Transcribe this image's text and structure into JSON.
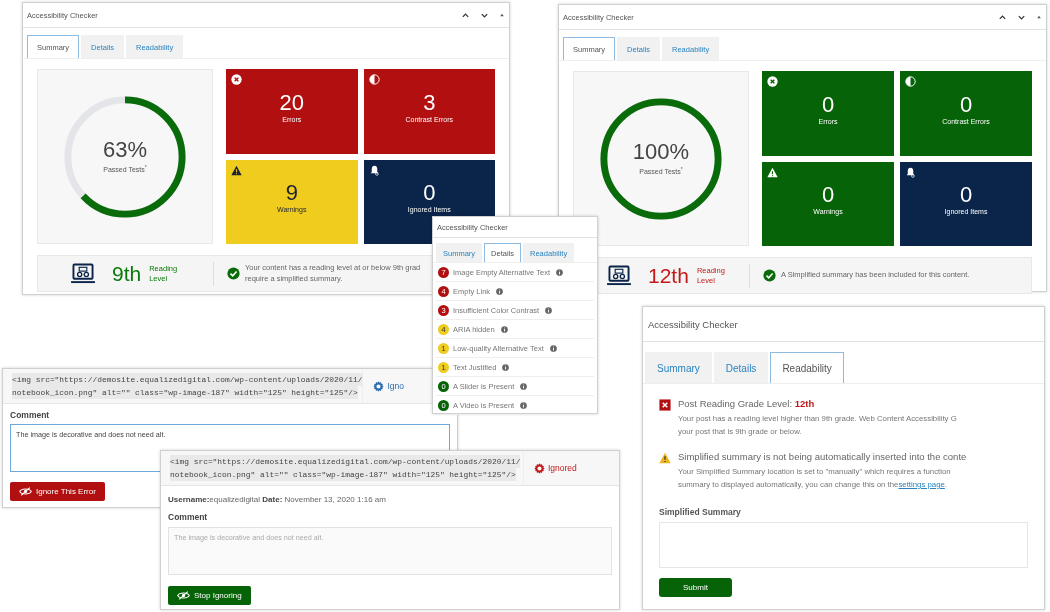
{
  "summary_panels": [
    {
      "title": "Accessibility Checker",
      "tabs": [
        {
          "label": "Summary",
          "selected": true
        },
        {
          "label": "Details",
          "selected": false
        },
        {
          "label": "Readability",
          "selected": false
        }
      ],
      "score": "63%",
      "score_label": "Passed Tests",
      "score_mark": "*",
      "level": 0.63,
      "tiles": [
        {
          "kind": "error",
          "count": "20",
          "label": "Errors",
          "color": "#b20f10"
        },
        {
          "kind": "contrast",
          "count": "3",
          "label": "Contrast Errors",
          "color": "#b20f10"
        },
        {
          "kind": "warning",
          "count": "9",
          "label": "Warnings",
          "color": "#f0cc1e"
        },
        {
          "kind": "ignored",
          "count": "0",
          "label": "Ignored Items",
          "color": "#0b254a"
        }
      ],
      "reading": {
        "grade": "9th",
        "label": [
          "Reading",
          "Level"
        ],
        "passed": true,
        "message_lines": [
          "Your content has a reading level at or below 9th grad",
          "require a simplified summary."
        ]
      }
    },
    {
      "title": "Accessibility Checker",
      "tabs": [
        {
          "label": "Summary",
          "selected": true
        },
        {
          "label": "Details",
          "selected": false
        },
        {
          "label": "Readability",
          "selected": false
        }
      ],
      "score": "100%",
      "score_label": "Passed Tests",
      "score_mark": "*",
      "level": 1,
      "tiles": [
        {
          "kind": "error",
          "count": "0",
          "label": "Errors",
          "color": "#076307"
        },
        {
          "kind": "contrast",
          "count": "0",
          "label": "Contrast Errors",
          "color": "#076307"
        },
        {
          "kind": "warning",
          "count": "0",
          "label": "Warnings",
          "color": "#076307"
        },
        {
          "kind": "ignored",
          "count": "0",
          "label": "Ignored Items",
          "color": "#0b254a"
        }
      ],
      "reading": {
        "grade": "12th",
        "label": [
          "Reading",
          "Level"
        ],
        "passed": false,
        "message_lines": [
          "A Simplified summary has been included for this content."
        ]
      }
    }
  ],
  "details_panel": {
    "title": "Accessibility Checker",
    "tabs": [
      {
        "label": "Summary",
        "selected": false
      },
      {
        "label": "Details",
        "selected": true
      },
      {
        "label": "Readability",
        "selected": false
      }
    ],
    "items": [
      {
        "count": "7",
        "label": "Image Empty Alternative Text",
        "color": "#b20f10"
      },
      {
        "count": "4",
        "label": "Empty Link",
        "color": "#b20f10"
      },
      {
        "count": "3",
        "label": "Insufficient Color Contrast",
        "color": "#b20f10"
      },
      {
        "count": "4",
        "label": "ARIA hidden",
        "color": "#f0cc1e"
      },
      {
        "count": "1",
        "label": "Low-quality Alternative Text",
        "color": "#f0cc1e"
      },
      {
        "count": "1",
        "label": "Text Justified",
        "color": "#f0cc1e"
      },
      {
        "count": "0",
        "label": "A Slider is Present",
        "color": "#076307"
      },
      {
        "count": "0",
        "label": "A Video is Present",
        "color": "#076307"
      }
    ]
  },
  "ignore_panels": [
    {
      "code_lines": [
        "<img src=\"https://demosite.equalizedigital.com/wp-content/uploads/2020/11/",
        "notebook_icon.png\" alt=\"\" class=\"wp-image-187\" width=\"125\" height=\"125\"/>"
      ],
      "status": "Igno",
      "ignored": false,
      "comment_label": "Comment",
      "comment": "The image is decorative and does not need alt.",
      "button": "Ignore This Error"
    },
    {
      "code_lines": [
        "<img src=\"https://demosite.equalizedigital.com/wp-content/uploads/2020/11/",
        "notebook_icon.png\" alt=\"\" class=\"wp-image-187\" width=\"125\" height=\"125\"/>"
      ],
      "status": "Ignored",
      "ignored": true,
      "meta": "**Username:**equalizedigital **Date:** November 13, 2020 1:16 am",
      "comment_label": "Comment",
      "comment": "The image is decorative and does not need alt.",
      "button": "Stop Ignoring"
    }
  ],
  "readability_panel": {
    "title": "Accessibility Checker",
    "tabs": [
      {
        "label": "Summary",
        "selected": false
      },
      {
        "label": "Details",
        "selected": false
      },
      {
        "label": "Readability",
        "selected": true
      }
    ],
    "notices": [
      {
        "kind": "error",
        "heading": "Post Reading Grade Level: **12th**",
        "body_lines": [
          "Your post has a reading level higher than 9th grade. Web Content Accessibility G",
          "your post that is 9th grade or below."
        ]
      },
      {
        "kind": "warning",
        "heading": "Simplified summary is not being automatically inserted into the conte",
        "body_lines": [
          "Your Simplified Summary location is set to \"manually\" which requires a function",
          "summary to displayed automatically, you can change this on the"
        ],
        "link": "settings page",
        "link_suffix": "."
      }
    ],
    "summary_label": "Simplified Summary",
    "submit": "Submit"
  }
}
